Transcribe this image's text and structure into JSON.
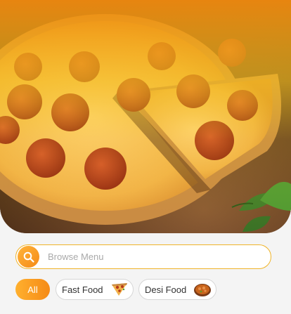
{
  "hero": {
    "image": "pepperoni-pizza-photo"
  },
  "search": {
    "placeholder": "Browse Menu",
    "icon": "search-icon"
  },
  "categories": [
    {
      "label": "All",
      "selected": true
    },
    {
      "label": "Fast Food",
      "thumbnail": "pizza-slice-thumbnail"
    },
    {
      "label": "Desi Food",
      "thumbnail": "curry-bowl-thumbnail"
    }
  ],
  "colors": {
    "accent": "#f5a623",
    "accent_dark": "#f58a16",
    "background": "#f4f4f4"
  }
}
